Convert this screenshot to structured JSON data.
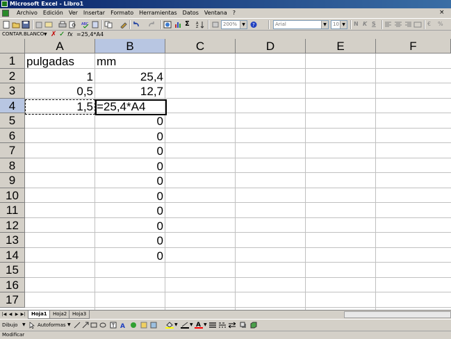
{
  "window": {
    "title": "Microsoft Excel - Libro1"
  },
  "menu": {
    "items": [
      "Archivo",
      "Edición",
      "Ver",
      "Insertar",
      "Formato",
      "Herramientas",
      "Datos",
      "Ventana",
      "?"
    ],
    "close_glyph": "×"
  },
  "toolbar": {
    "zoom": "200%",
    "font": "Arial",
    "font_size": "10",
    "sum_glyph": "Σ",
    "bold": "N",
    "italic": "K",
    "underline": "S",
    "euro": "€",
    "percent": "%"
  },
  "formula_bar": {
    "name_box": "CONTAR.BLANCO",
    "fx": "fx",
    "content": "=25,4*A4"
  },
  "grid": {
    "columns": [
      "A",
      "B",
      "C",
      "D",
      "E",
      "F"
    ],
    "rows": [
      "1",
      "2",
      "3",
      "4",
      "5",
      "6",
      "7",
      "8",
      "9",
      "10",
      "11",
      "12",
      "13",
      "14",
      "15",
      "16",
      "17"
    ],
    "cells": {
      "A1": "pulgadas",
      "B1": "mm",
      "A2": "1",
      "B2": "25,4",
      "A3": "0,5",
      "B3": "12,7",
      "A4": "1,5",
      "B4": "=25,4*A4",
      "B5": "0",
      "B6": "0",
      "B7": "0",
      "B8": "0",
      "B9": "0",
      "B10": "0",
      "B11": "0",
      "B12": "0",
      "B13": "0",
      "B14": "0"
    }
  },
  "sheets": {
    "tabs": [
      "Hoja1",
      "Hoja2",
      "Hoja3"
    ],
    "active": "Hoja1"
  },
  "draw_toolbar": {
    "dibujo": "Dibujo",
    "autoformas": "Autoformas"
  },
  "status": {
    "text": "Modificar"
  }
}
